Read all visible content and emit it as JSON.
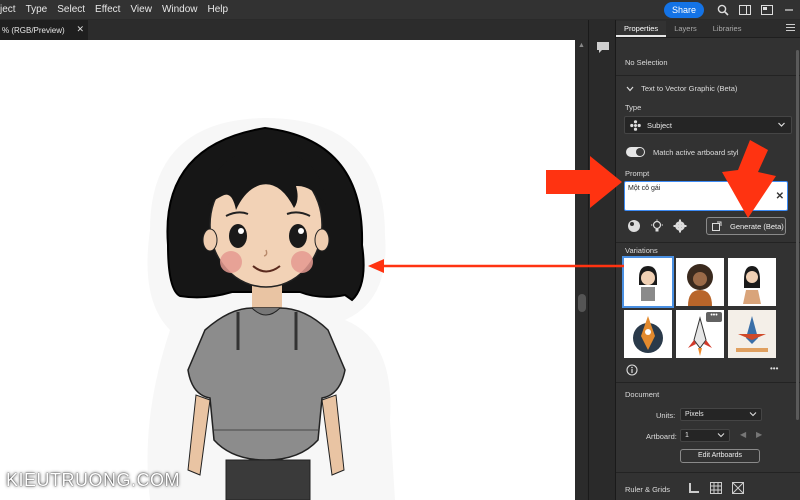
{
  "menubar": {
    "items": [
      "ject",
      "Type",
      "Select",
      "Effect",
      "View",
      "Window",
      "Help"
    ],
    "share_label": "Share"
  },
  "document": {
    "tab_title": "% (RGB/Preview)",
    "close_glyph": "✕"
  },
  "panel": {
    "tabs": [
      "Properties",
      "Layers",
      "Libraries"
    ],
    "active_tab": "Properties",
    "selection_status": "No Selection",
    "section_title": "Text to Vector Graphic (Beta)",
    "type_label": "Type",
    "type_value": "Subject",
    "match_style_label": "Match active artboard styl",
    "match_style_on": true,
    "prompt_label": "Prompt",
    "prompt_value": "Một cô gái",
    "generate_label": "Generate (Beta)",
    "variations_label": "Variations",
    "variation_more": "•••",
    "info_more": "•••",
    "document_label": "Document",
    "units_label": "Units:",
    "units_value": "Pixels",
    "artboard_label": "Artboard:",
    "artboard_value": "1",
    "edit_artboards_label": "Edit Artboards",
    "ruler_grids_label": "Ruler & Grids"
  },
  "watermark": "KIEUTRUONG.COM",
  "colors": {
    "accent_blue": "#1473e6",
    "annotation_red": "#ff3311",
    "panel_bg": "#323232",
    "canvas_bg": "#ffffff"
  },
  "icons": [
    "search-icon",
    "workspace-icon",
    "arrange-icon",
    "minimize-icon",
    "comment-icon",
    "subject-icon",
    "chevron-down-icon",
    "close-icon",
    "style-picker-icon",
    "bulb-icon",
    "gear-icon",
    "generate-icon",
    "info-icon"
  ]
}
